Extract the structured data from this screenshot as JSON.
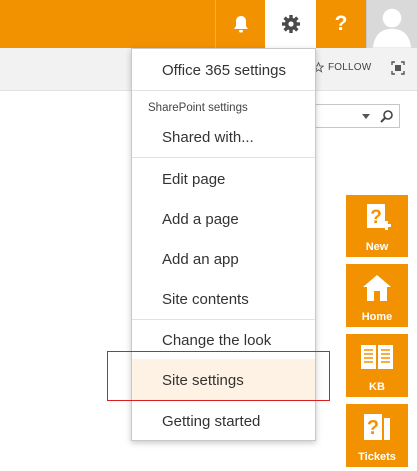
{
  "suite_bar": {
    "help_label": "?",
    "colors": {
      "brand": "#f39200",
      "gear_bg": "#ffffff"
    },
    "icons": [
      "bell-icon",
      "gear-icon",
      "help-icon",
      "avatar-icon"
    ]
  },
  "ribbon": {
    "follow_label": "FOLLOW"
  },
  "menu": {
    "office_settings": "Office 365 settings",
    "sharepoint_header": "SharePoint settings",
    "items": [
      "Shared with...",
      "Edit page",
      "Add a page",
      "Add an app",
      "Site contents",
      "Change the look",
      "Site settings",
      "Getting started"
    ],
    "highlighted_item": "Site settings",
    "highlight_color": "#fdf2e4",
    "callout_color": "#d81f1f"
  },
  "tiles": [
    {
      "label": "New",
      "icon": "new-page-icon"
    },
    {
      "label": "Home",
      "icon": "home-icon"
    },
    {
      "label": "KB",
      "icon": "book-icon"
    },
    {
      "label": "Tickets",
      "icon": "ticket-icon"
    }
  ]
}
